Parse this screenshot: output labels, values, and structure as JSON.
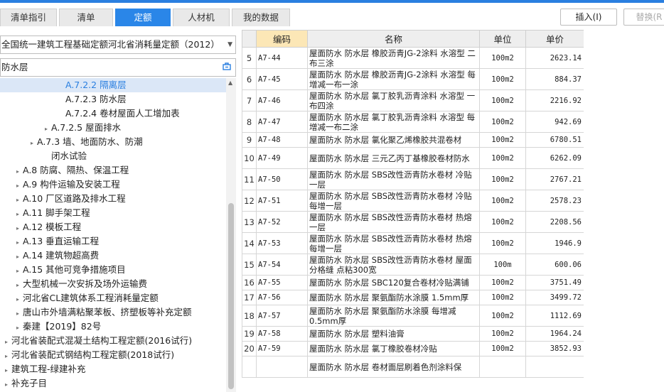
{
  "tabs": [
    {
      "label": "清单指引",
      "active": false
    },
    {
      "label": "清单",
      "active": false
    },
    {
      "label": "定额",
      "active": true
    },
    {
      "label": "人材机",
      "active": false
    },
    {
      "label": "我的数据",
      "active": false
    }
  ],
  "actions": {
    "insert": "插入(I)",
    "replace": "替换(R"
  },
  "left": {
    "dropdown_value": "全国统一建筑工程基础定额河北省消耗量定额（2012）",
    "search_value": "防水层"
  },
  "tree": [
    {
      "label": "A.7.2.2 隔离层",
      "indent": 78,
      "arrow": "",
      "selected": true
    },
    {
      "label": "A.7.2.3 防水层",
      "indent": 78,
      "arrow": ""
    },
    {
      "label": "A.7.2.4 卷材屋面人工增加表",
      "indent": 78,
      "arrow": ""
    },
    {
      "label": "A.7.2.5 屋面排水",
      "indent": 58,
      "arrow": "▸"
    },
    {
      "label": "A.7.3 墙、地面防水、防潮",
      "indent": 38,
      "arrow": "▸"
    },
    {
      "label": "闭水试验",
      "indent": 58,
      "arrow": ""
    },
    {
      "label": "A.8 防腐、隔热、保温工程",
      "indent": 18,
      "arrow": "▸"
    },
    {
      "label": "A.9 构件运输及安装工程",
      "indent": 18,
      "arrow": "▸"
    },
    {
      "label": "A.10 厂区道路及排水工程",
      "indent": 18,
      "arrow": "▸"
    },
    {
      "label": "A.11 脚手架工程",
      "indent": 18,
      "arrow": "▸"
    },
    {
      "label": "A.12 模板工程",
      "indent": 18,
      "arrow": "▸"
    },
    {
      "label": "A.13 垂直运输工程",
      "indent": 18,
      "arrow": "▸"
    },
    {
      "label": "A.14 建筑物超高费",
      "indent": 18,
      "arrow": "▸"
    },
    {
      "label": "A.15 其他可竞争措施项目",
      "indent": 18,
      "arrow": "▸"
    },
    {
      "label": "大型机械一次安拆及场外运输费",
      "indent": 18,
      "arrow": "▸"
    },
    {
      "label": "河北省CL建筑体系工程消耗量定额",
      "indent": 18,
      "arrow": "▸"
    },
    {
      "label": "唐山市外墙满粘聚苯板、挤塑板等补充定额",
      "indent": 18,
      "arrow": "▸"
    },
    {
      "label": "秦建【2019】82号",
      "indent": 18,
      "arrow": "▸"
    },
    {
      "label": "河北省装配式混凝土结构工程定额(2016试行)",
      "indent": 2,
      "arrow": "▸"
    },
    {
      "label": "河北省装配式钢结构工程定额(2018试行)",
      "indent": 2,
      "arrow": "▸"
    },
    {
      "label": "建筑工程-绿建补充",
      "indent": 2,
      "arrow": "▸"
    },
    {
      "label": "补充子目",
      "indent": 2,
      "arrow": "▸"
    }
  ],
  "table": {
    "columns": [
      "",
      "编码",
      "名称",
      "单位",
      "单价"
    ],
    "rows": [
      {
        "no": "5",
        "code": "A7-44",
        "name": "屋面防水 防水层 橡胶沥青JG-2涂料 水溶型 二布三涂",
        "unit": "100m2",
        "price": "2623.14"
      },
      {
        "no": "6",
        "code": "A7-45",
        "name": "屋面防水 防水层 橡胶沥青JG-2涂料 水溶型 每增减一布一涂",
        "unit": "100m2",
        "price": "884.37"
      },
      {
        "no": "7",
        "code": "A7-46",
        "name": "屋面防水 防水层 氯丁胶乳沥青涂料 水溶型 一布四涂",
        "unit": "100m2",
        "price": "2216.92"
      },
      {
        "no": "8",
        "code": "A7-47",
        "name": "屋面防水 防水层 氯丁胶乳沥青涂料 水溶型 每增减一布二涂",
        "unit": "100m2",
        "price": "942.69"
      },
      {
        "no": "9",
        "code": "A7-48",
        "name": "屋面防水 防水层 氯化聚乙烯橡胶共混卷材",
        "unit": "100m2",
        "price": "6780.51",
        "short": true
      },
      {
        "no": "10",
        "code": "A7-49",
        "name": "屋面防水 防水层 三元乙丙丁基橡胶卷材防水",
        "unit": "100m2",
        "price": "6262.09"
      },
      {
        "no": "11",
        "code": "A7-50",
        "name": "屋面防水 防水层 SBS改性沥青防水卷材 冷贴 一层",
        "unit": "100m2",
        "price": "2767.21"
      },
      {
        "no": "12",
        "code": "A7-51",
        "name": "屋面防水 防水层 SBS改性沥青防水卷材 冷贴 每增一层",
        "unit": "100m2",
        "price": "2578.23"
      },
      {
        "no": "13",
        "code": "A7-52",
        "name": "屋面防水 防水层 SBS改性沥青防水卷材 热熔 一层",
        "unit": "100m2",
        "price": "2208.56"
      },
      {
        "no": "14",
        "code": "A7-53",
        "name": "屋面防水 防水层 SBS改性沥青防水卷材 热熔 每增一层",
        "unit": "100m2",
        "price": "1946.9"
      },
      {
        "no": "15",
        "code": "A7-54",
        "name": "屋面防水 防水层 SBS改性沥青防水卷材 屋面分格缝 点粘300宽",
        "unit": "100m",
        "price": "600.06"
      },
      {
        "no": "16",
        "code": "A7-55",
        "name": "屋面防水 防水层 SBC120复合卷材冷贴满铺",
        "unit": "100m2",
        "price": "3751.49",
        "short": true
      },
      {
        "no": "17",
        "code": "A7-56",
        "name": "屋面防水 防水层 聚氨酯防水涂膜 1.5mm厚",
        "unit": "100m2",
        "price": "3499.72",
        "short": true
      },
      {
        "no": "18",
        "code": "A7-57",
        "name": "屋面防水 防水层 聚氨酯防水涂膜 每增减0.5mm厚",
        "unit": "100m2",
        "price": "1112.69"
      },
      {
        "no": "19",
        "code": "A7-58",
        "name": "屋面防水 防水层 塑料油膏",
        "unit": "100m2",
        "price": "1964.24",
        "short": true
      },
      {
        "no": "20",
        "code": "A7-59",
        "name": "屋面防水 防水层 氯丁橡胶卷材冷贴",
        "unit": "100m2",
        "price": "3852.93",
        "short": true
      },
      {
        "no": "",
        "code": "",
        "name": "屋面防水 防水层 卷材面层刷着色剂涂料保",
        "unit": "",
        "price": ""
      }
    ]
  }
}
